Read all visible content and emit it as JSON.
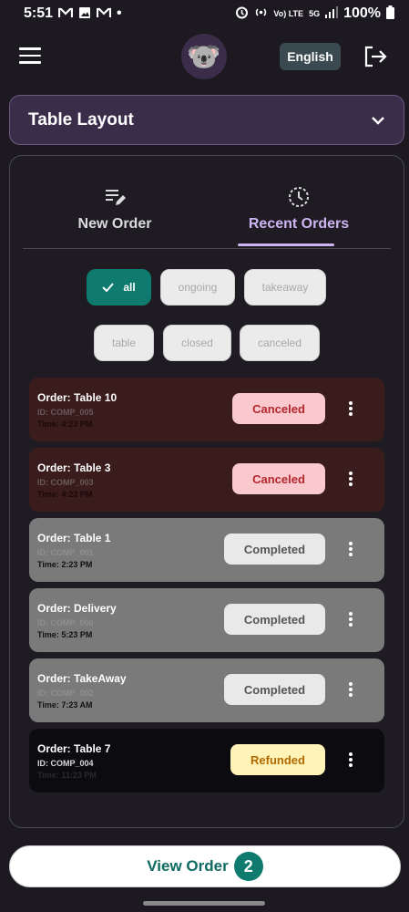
{
  "status_bar": {
    "time": "5:51",
    "left_icons": [
      "mail-icon",
      "image-icon",
      "mail-icon"
    ],
    "dot": "•",
    "volte": "Vo) LTE",
    "network": "5G",
    "battery": "100%"
  },
  "header": {
    "avatar": "🐨",
    "language_label": "English"
  },
  "dropdown": {
    "label": "Table Layout"
  },
  "tabs": {
    "new_order_label": "New Order",
    "recent_orders_label": "Recent Orders",
    "active": "Recent Orders"
  },
  "filters": {
    "row1": [
      "all",
      "ongoing",
      "takeaway"
    ],
    "row2": [
      "table",
      "closed",
      "canceled"
    ],
    "selected": "all"
  },
  "orders": [
    {
      "title": "Order: Table 10",
      "id": "ID: COMP_005",
      "time": "Time: 4:23 PM",
      "status": "Canceled"
    },
    {
      "title": "Order: Table 3",
      "id": "ID: COMP_003",
      "time": "Time: 4:23 PM",
      "status": "Canceled"
    },
    {
      "title": "Order: Table 1",
      "id": "ID: COMP_001",
      "time": "Time: 2:23 PM",
      "status": "Completed"
    },
    {
      "title": "Order: Delivery",
      "id": "ID: COMP_006",
      "time": "Time: 5:23 PM",
      "status": "Completed"
    },
    {
      "title": "Order: TakeAway",
      "id": "ID: COMP_002",
      "time": "Time: 7:23 AM",
      "status": "Completed"
    },
    {
      "title": "Order: Table 7",
      "id": "ID: COMP_004",
      "time": "Time: 11:23 PM",
      "status": "Refunded"
    }
  ],
  "view_order": {
    "label": "View Order",
    "count": "2"
  },
  "colors": {
    "accent": "#0f7a6e",
    "tab_active": "#cdb4f2",
    "canceled_bg": "#f9c9ce",
    "completed_bg": "#e9e9e9",
    "refunded_bg": "#fff3b8"
  }
}
